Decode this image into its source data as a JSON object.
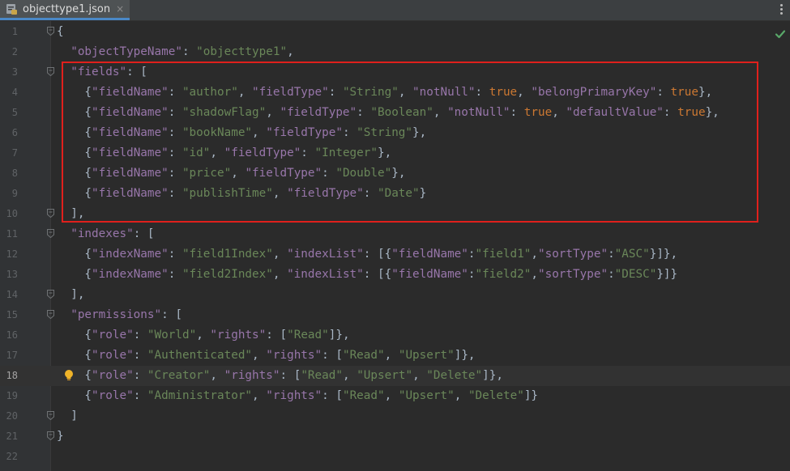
{
  "tab": {
    "filename": "objecttype1.json",
    "close": "×"
  },
  "highlight_color": "#e0201c",
  "lines": [
    {
      "n": "1",
      "t": [
        [
          "p",
          "{"
        ]
      ]
    },
    {
      "n": "2",
      "t": [
        [
          "p",
          "  "
        ],
        [
          "k",
          "\"objectTypeName\""
        ],
        [
          "p",
          ": "
        ],
        [
          "s",
          "\"objecttype1\""
        ],
        [
          "p",
          ","
        ]
      ]
    },
    {
      "n": "3",
      "t": [
        [
          "p",
          "  "
        ],
        [
          "k",
          "\"fields\""
        ],
        [
          "p",
          ": ["
        ]
      ]
    },
    {
      "n": "4",
      "t": [
        [
          "p",
          "    {"
        ],
        [
          "k",
          "\"fieldName\""
        ],
        [
          "p",
          ": "
        ],
        [
          "s",
          "\"author\""
        ],
        [
          "p",
          ", "
        ],
        [
          "k",
          "\"fieldType\""
        ],
        [
          "p",
          ": "
        ],
        [
          "s",
          "\"String\""
        ],
        [
          "p",
          ", "
        ],
        [
          "k",
          "\"notNull\""
        ],
        [
          "p",
          ": "
        ],
        [
          "kw",
          "true"
        ],
        [
          "p",
          ", "
        ],
        [
          "k",
          "\"belongPrimaryKey\""
        ],
        [
          "p",
          ": "
        ],
        [
          "kw",
          "true"
        ],
        [
          "p",
          "},"
        ]
      ]
    },
    {
      "n": "5",
      "t": [
        [
          "p",
          "    {"
        ],
        [
          "k",
          "\"fieldName\""
        ],
        [
          "p",
          ": "
        ],
        [
          "s",
          "\"shadowFlag\""
        ],
        [
          "p",
          ", "
        ],
        [
          "k",
          "\"fieldType\""
        ],
        [
          "p",
          ": "
        ],
        [
          "s",
          "\"Boolean\""
        ],
        [
          "p",
          ", "
        ],
        [
          "k",
          "\"notNull\""
        ],
        [
          "p",
          ": "
        ],
        [
          "kw",
          "true"
        ],
        [
          "p",
          ", "
        ],
        [
          "k",
          "\"defaultValue\""
        ],
        [
          "p",
          ": "
        ],
        [
          "kw",
          "true"
        ],
        [
          "p",
          "},"
        ]
      ]
    },
    {
      "n": "6",
      "t": [
        [
          "p",
          "    {"
        ],
        [
          "k",
          "\"fieldName\""
        ],
        [
          "p",
          ": "
        ],
        [
          "s",
          "\"bookName\""
        ],
        [
          "p",
          ", "
        ],
        [
          "k",
          "\"fieldType\""
        ],
        [
          "p",
          ": "
        ],
        [
          "s",
          "\"String\""
        ],
        [
          "p",
          "},"
        ]
      ]
    },
    {
      "n": "7",
      "t": [
        [
          "p",
          "    {"
        ],
        [
          "k",
          "\"fieldName\""
        ],
        [
          "p",
          ": "
        ],
        [
          "s",
          "\"id\""
        ],
        [
          "p",
          ", "
        ],
        [
          "k",
          "\"fieldType\""
        ],
        [
          "p",
          ": "
        ],
        [
          "s",
          "\"Integer\""
        ],
        [
          "p",
          "},"
        ]
      ]
    },
    {
      "n": "8",
      "t": [
        [
          "p",
          "    {"
        ],
        [
          "k",
          "\"fieldName\""
        ],
        [
          "p",
          ": "
        ],
        [
          "s",
          "\"price\""
        ],
        [
          "p",
          ", "
        ],
        [
          "k",
          "\"fieldType\""
        ],
        [
          "p",
          ": "
        ],
        [
          "s",
          "\"Double\""
        ],
        [
          "p",
          "},"
        ]
      ]
    },
    {
      "n": "9",
      "t": [
        [
          "p",
          "    {"
        ],
        [
          "k",
          "\"fieldName\""
        ],
        [
          "p",
          ": "
        ],
        [
          "s",
          "\"publishTime\""
        ],
        [
          "p",
          ", "
        ],
        [
          "k",
          "\"fieldType\""
        ],
        [
          "p",
          ": "
        ],
        [
          "s",
          "\"Date\""
        ],
        [
          "p",
          "}"
        ]
      ]
    },
    {
      "n": "10",
      "t": [
        [
          "p",
          "  ],"
        ]
      ]
    },
    {
      "n": "11",
      "t": [
        [
          "p",
          "  "
        ],
        [
          "k",
          "\"indexes\""
        ],
        [
          "p",
          ": ["
        ]
      ]
    },
    {
      "n": "12",
      "t": [
        [
          "p",
          "    {"
        ],
        [
          "k",
          "\"indexName\""
        ],
        [
          "p",
          ": "
        ],
        [
          "s",
          "\"field1Index\""
        ],
        [
          "p",
          ", "
        ],
        [
          "k",
          "\"indexList\""
        ],
        [
          "p",
          ": [{"
        ],
        [
          "k",
          "\"fieldName\""
        ],
        [
          "p",
          ":"
        ],
        [
          "s",
          "\"field1\""
        ],
        [
          "p",
          ","
        ],
        [
          "k",
          "\"sortType\""
        ],
        [
          "p",
          ":"
        ],
        [
          "s",
          "\"ASC\""
        ],
        [
          "p",
          "}]},"
        ]
      ]
    },
    {
      "n": "13",
      "t": [
        [
          "p",
          "    {"
        ],
        [
          "k",
          "\"indexName\""
        ],
        [
          "p",
          ": "
        ],
        [
          "s",
          "\"field2Index\""
        ],
        [
          "p",
          ", "
        ],
        [
          "k",
          "\"indexList\""
        ],
        [
          "p",
          ": [{"
        ],
        [
          "k",
          "\"fieldName\""
        ],
        [
          "p",
          ":"
        ],
        [
          "s",
          "\"field2\""
        ],
        [
          "p",
          ","
        ],
        [
          "k",
          "\"sortType\""
        ],
        [
          "p",
          ":"
        ],
        [
          "s",
          "\"DESC\""
        ],
        [
          "p",
          "}]}"
        ]
      ]
    },
    {
      "n": "14",
      "t": [
        [
          "p",
          "  ],"
        ]
      ]
    },
    {
      "n": "15",
      "t": [
        [
          "p",
          "  "
        ],
        [
          "k",
          "\"permissions\""
        ],
        [
          "p",
          ": ["
        ]
      ]
    },
    {
      "n": "16",
      "t": [
        [
          "p",
          "    {"
        ],
        [
          "k",
          "\"role\""
        ],
        [
          "p",
          ": "
        ],
        [
          "s",
          "\"World\""
        ],
        [
          "p",
          ", "
        ],
        [
          "k",
          "\"rights\""
        ],
        [
          "p",
          ": ["
        ],
        [
          "s",
          "\"Read\""
        ],
        [
          "p",
          "]},"
        ]
      ]
    },
    {
      "n": "17",
      "t": [
        [
          "p",
          "    {"
        ],
        [
          "k",
          "\"role\""
        ],
        [
          "p",
          ": "
        ],
        [
          "s",
          "\"Authenticated\""
        ],
        [
          "p",
          ", "
        ],
        [
          "k",
          "\"rights\""
        ],
        [
          "p",
          ": ["
        ],
        [
          "s",
          "\"Read\""
        ],
        [
          "p",
          ", "
        ],
        [
          "s",
          "\"Upsert\""
        ],
        [
          "p",
          "]},"
        ]
      ]
    },
    {
      "n": "18",
      "t": [
        [
          "p",
          "    {"
        ],
        [
          "k",
          "\"role\""
        ],
        [
          "p",
          ": "
        ],
        [
          "s",
          "\"Creator\""
        ],
        [
          "p",
          ", "
        ],
        [
          "k",
          "\"rights\""
        ],
        [
          "p",
          ": ["
        ],
        [
          "s",
          "\"Read\""
        ],
        [
          "p",
          ", "
        ],
        [
          "s",
          "\"Upsert\""
        ],
        [
          "p",
          ", "
        ],
        [
          "s",
          "\"Delete\""
        ],
        [
          "p",
          "]},"
        ]
      ]
    },
    {
      "n": "19",
      "t": [
        [
          "p",
          "    {"
        ],
        [
          "k",
          "\"role\""
        ],
        [
          "p",
          ": "
        ],
        [
          "s",
          "\"Administrator\""
        ],
        [
          "p",
          ", "
        ],
        [
          "k",
          "\"rights\""
        ],
        [
          "p",
          ": ["
        ],
        [
          "s",
          "\"Read\""
        ],
        [
          "p",
          ", "
        ],
        [
          "s",
          "\"Upsert\""
        ],
        [
          "p",
          ", "
        ],
        [
          "s",
          "\"Delete\""
        ],
        [
          "p",
          "]}"
        ]
      ]
    },
    {
      "n": "20",
      "t": [
        [
          "p",
          "  ]"
        ]
      ]
    },
    {
      "n": "21",
      "t": [
        [
          "p",
          "}"
        ]
      ]
    },
    {
      "n": "22",
      "t": []
    }
  ],
  "current_line": "18",
  "fold_lines": [
    "1",
    "3",
    "10",
    "11",
    "14",
    "15",
    "20",
    "21"
  ],
  "bulb_line": "18"
}
